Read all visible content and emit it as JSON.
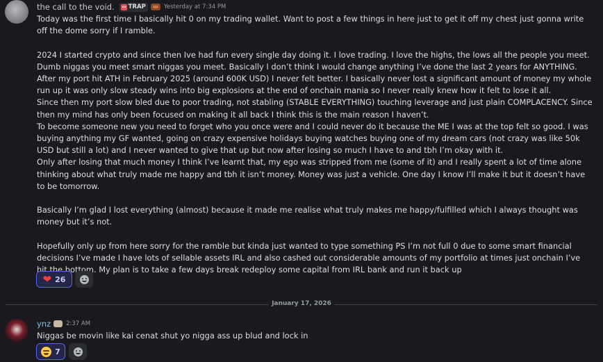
{
  "messages": [
    {
      "author": "the call to the void.",
      "tag_label": "TRAP",
      "timestamp": "Yesterday at 7:34 PM",
      "paragraphs": [
        "Today was the first time I basically hit 0 on my trading wallet. Want to post a few things in here just to get it off my chest just gonna write off the dome sorry if I ramble.",
        "",
        "2024 I started crypto and since then Ive had fun every single day doing it. I love trading. I love the highs, the lows all the people you meet. Dumb niggas you meet smart niggas you meet. Basically I don’t think I would change anything I’ve done the last 2 years for ANYTHING. After my port hit ATH in February 2025 (around 600K USD) I never felt better. I basically never lost a significant amount of money my whole run up it was only slow steady wins into big explosions at the end of onchain mania so I never really knew how it felt to lose it all.",
        "Since then my port slow bled due to poor trading, not stabling (STABLE EVERYTHING) touching leverage and just plain COMPLACENCY. Since then my mind has only been focused on making it all back I think this is the main reason I haven’t.",
        "To become someone new you need to forget who you once were and I could never do it because the ME I was at the top felt so good. I was buying anything my GF wanted, going on crazy expensive holidays buying watches buying one of my dream cars (not crazy was like 50k USD but still a lot) and I never wanted to give that up but now after losing so much I have to and tbh I’m okay with it.",
        "Only after losing that much money I think I’ve learnt that, my ego was stripped from me (some of it) and I really spent a lot of time alone thinking about what truly made me happy and tbh it isn’t money. Money was just a vehicle. One day I know I’ll make it but it doesn’t have to be tomorrow.",
        "",
        "Basically I’m glad I lost everything (almost) because it made me realise what truly makes me happy/fulfilled which I always thought was money but it’s not.",
        "",
        "Hopefully only up from here sorry for the ramble but kinda just wanted to type something PS I’m not full 0 due to some smart financial decisions I’ve made I have lots of sellable assets IRL and also cashed out considerable amounts of my portfolio at times just onchain I’ve hit the bottom. My plan is to take a few days break redeploy some capital from IRL bank and run it back up"
      ],
      "reactions": [
        {
          "emoji": "heart",
          "count": "26"
        }
      ]
    },
    {
      "author": "ynz",
      "timestamp": "2:37 AM",
      "paragraphs": [
        "Niggas be movin like kai cenat shut yo nigga ass up blud and lock in"
      ],
      "reactions": [
        {
          "emoji": "crying-face",
          "count": "7"
        }
      ]
    }
  ],
  "date_divider": "January 17, 2026",
  "colors": {
    "background": "#1a1a1e",
    "text": "#dbdee1",
    "username_2": "#7bc7e8",
    "reaction_border": "#5865f2"
  }
}
